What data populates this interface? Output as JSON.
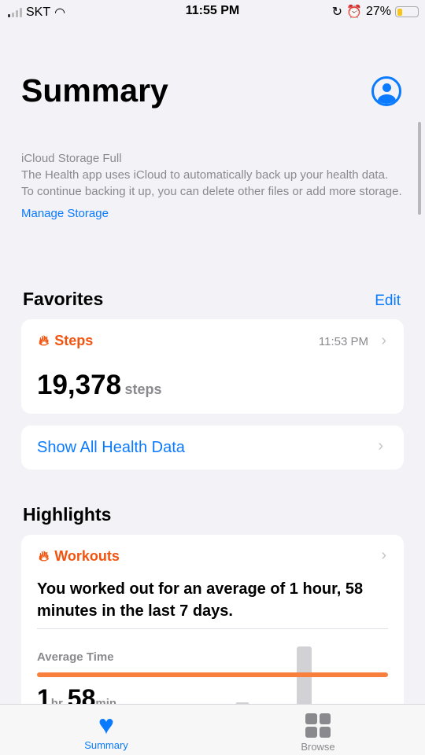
{
  "status": {
    "carrier": "SKT",
    "time": "11:55 PM",
    "battery": "27%",
    "battery_level": 0.27
  },
  "header": {
    "title": "Summary"
  },
  "icloud": {
    "title": "iCloud Storage Full",
    "body": "The Health app uses iCloud to automatically back up your health data. To continue backing it up, you can delete other files or add more storage.",
    "link": "Manage Storage"
  },
  "favorites": {
    "title": "Favorites",
    "edit": "Edit",
    "steps": {
      "label": "Steps",
      "time": "11:53 PM",
      "value": "19,378",
      "unit": "steps"
    },
    "show_all": "Show All Health Data"
  },
  "highlights": {
    "title": "Highlights",
    "workouts": {
      "label": "Workouts",
      "text": "You worked out for an average of 1 hour, 58 minutes in the last 7 days.",
      "avg_label": "Average Time",
      "hours": "1",
      "hr": "hr",
      "minutes": "58",
      "min": "min"
    }
  },
  "tabs": [
    {
      "label": "Summary",
      "active": true
    },
    {
      "label": "Browse",
      "active": false
    }
  ],
  "colors": {
    "accent": "#0a7aff",
    "orange": "#f2540f"
  }
}
